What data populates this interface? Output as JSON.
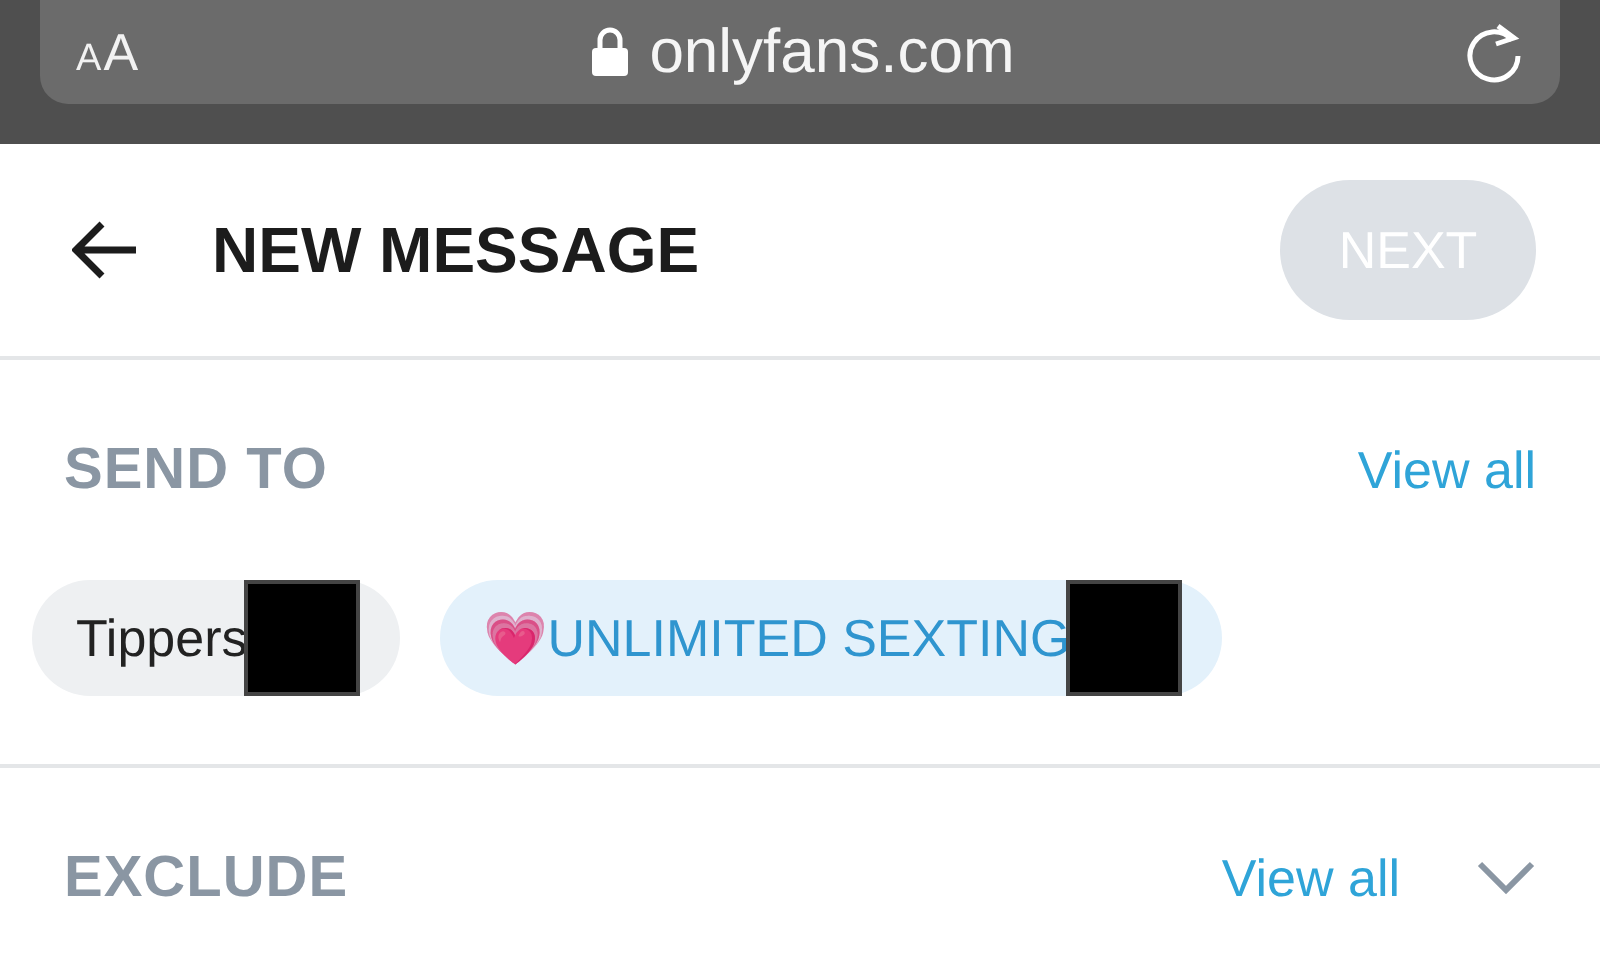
{
  "browser": {
    "text_size": "AA",
    "url": "onlyfans.com"
  },
  "header": {
    "title": "NEW MESSAGE",
    "next_button": {
      "label": "NEXT",
      "disabled": true
    }
  },
  "send_to": {
    "title": "SEND TO",
    "view_all": "View all",
    "chips": [
      {
        "label": "Tippers",
        "kind": "plain"
      },
      {
        "label": "💗UNLIMITED SEXTING",
        "kind": "list"
      }
    ]
  },
  "exclude": {
    "title": "EXCLUDE",
    "view_all": "View all",
    "expanded": false
  }
}
